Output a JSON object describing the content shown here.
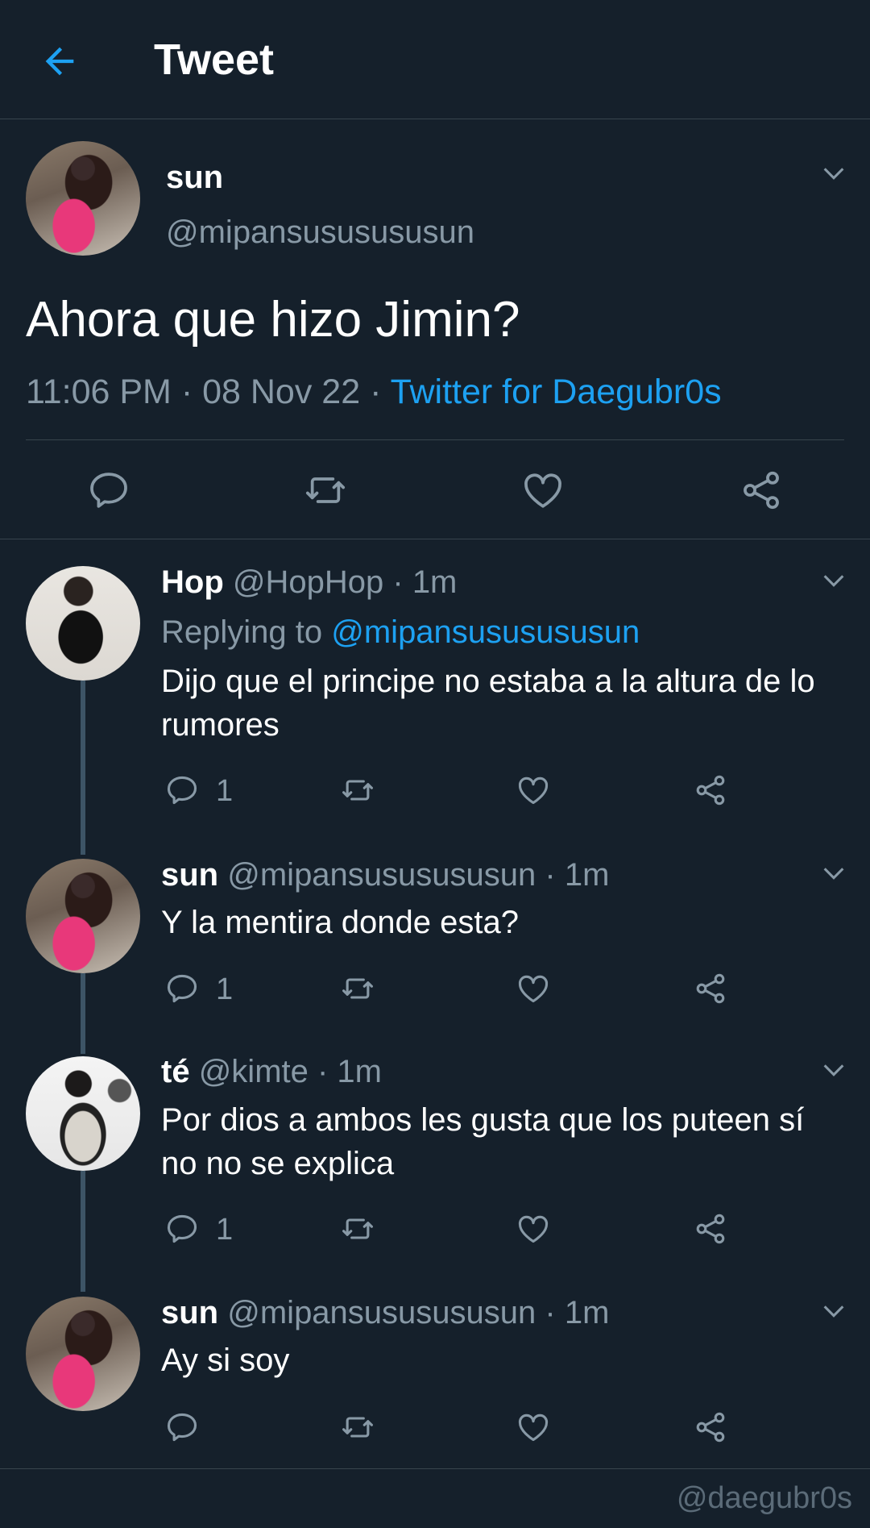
{
  "header": {
    "title": "Tweet",
    "back_icon": "arrow-left-icon"
  },
  "colors": {
    "background": "#15202b",
    "accent": "#1da1f2",
    "muted": "#8899a6",
    "divider": "#38444d"
  },
  "main_tweet": {
    "name": "sun",
    "handle": "@mipansususususun",
    "text": "Ahora que hizo Jimin?",
    "time": "11:06 PM",
    "date": "08 Nov 22",
    "source": "Twitter for Daegubr0s",
    "separator": " · "
  },
  "replies": [
    {
      "name": "Hop",
      "handle": "@HopHop",
      "time": "1m",
      "replying_label": "Replying to",
      "replying_handle": "@mipansususususun",
      "text": "Dijo que el principe no estaba a la altura de lo rumores",
      "reply_count": "1"
    },
    {
      "name": "sun",
      "handle": "@mipansususususun",
      "time": "1m",
      "text": "Y la mentira donde esta?",
      "reply_count": "1"
    },
    {
      "name": "té",
      "handle": "@kimte",
      "time": "1m",
      "text": "Por dios a ambos les gusta que los puteen sí no no se explica",
      "reply_count": "1"
    },
    {
      "name": "sun",
      "handle": "@mipansususususun",
      "time": "1m",
      "text": "Ay si soy",
      "reply_count": ""
    }
  ],
  "watermark": "@daegubr0s"
}
